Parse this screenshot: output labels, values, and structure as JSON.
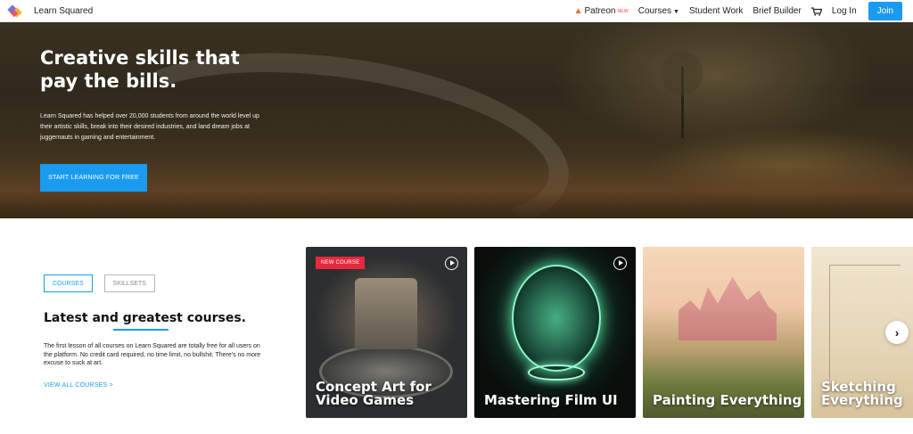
{
  "nav": {
    "brand": "Learn Squared",
    "patreon": "Patreon",
    "patreon_tag": "NEW",
    "courses": "Courses",
    "student_work": "Student Work",
    "brief_builder": "Brief Builder",
    "login": "Log In",
    "join": "Join",
    "icons": [
      "logo-icon",
      "flame-icon",
      "chevron-down-icon",
      "cart-icon"
    ]
  },
  "hero": {
    "title_line1": "Creative skills that",
    "title_line2": "pay the bills.",
    "description": "Learn Squared has helped over 20,000 students from around the world level up their artistic skills, break into their desired industries, and land dream jobs at juggernauts in gaming and entertainment.",
    "cta": "START LEARNING FOR FREE"
  },
  "courses_section": {
    "tabs": [
      "COURSES",
      "SKILLSETS"
    ],
    "active_tab": "COURSES",
    "title": "Latest and greatest courses.",
    "description": "The first lesson of all courses on Learn Squared are totally free for all users on the platform. No credit card required, no time limit, no bullshit. There's no more excuse to suck at art.",
    "view_all": "VIEW ALL COURSES >"
  },
  "cards": [
    {
      "title": "Concept Art for Video Games",
      "badge": "NEW COURSE"
    },
    {
      "title": "Mastering Film UI"
    },
    {
      "title": "Painting Everything"
    },
    {
      "title": "Sketching Everything"
    }
  ],
  "colors": {
    "accent": "#1a9bf0",
    "badge": "#e8283c",
    "patreon_flame": "#f26a2e"
  }
}
